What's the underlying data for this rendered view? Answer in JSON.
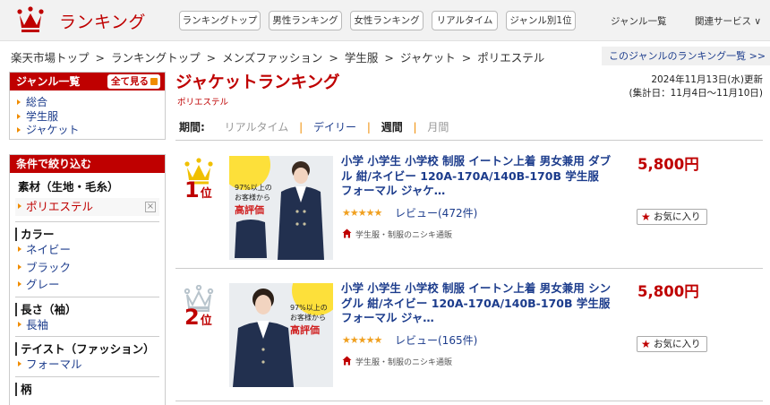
{
  "header": {
    "brand": "ランキング",
    "nav_buttons": [
      "ランキングトップ",
      "男性ランキング",
      "女性ランキング",
      "リアルタイム",
      "ジャンル別1位"
    ],
    "genre_list_link": "ジャンル一覧",
    "related_services": "関連サービス ∨"
  },
  "breadcrumb": {
    "items": [
      "楽天市場トップ",
      "ランキングトップ",
      "メンズファッション",
      "学生服",
      "ジャケット",
      "ポリエステル"
    ],
    "separator": ">"
  },
  "genre_ranking_link": "このジャンルのランキング一覧 >>",
  "sidebar": {
    "genre_title": "ジャンル一覧",
    "show_all": "全て見る",
    "genres": [
      "総合",
      "学生服",
      "ジャケット"
    ],
    "filter_title": "条件で絞り込む",
    "material_title": "素材（生地・毛糸）",
    "material_selected": "ポリエステル",
    "remove_icon_text": "×",
    "color_title": "カラー",
    "colors": [
      "ネイビー",
      "ブラック",
      "グレー"
    ],
    "sleeve_title": "長さ（袖）",
    "sleeves": [
      "長袖"
    ],
    "taste_title": "テイスト（ファッション）",
    "tastes": [
      "フォーマル"
    ],
    "pattern_title": "柄"
  },
  "main": {
    "title": "ジャケットランキング",
    "subtitle": "ポリエステル",
    "updated_line1": "2024年11月13日(水)更新",
    "updated_line2": "(集計日：11月4日～11月10日)",
    "period_label": "期間:",
    "periods": [
      {
        "label": "リアルタイム",
        "state": "disabled"
      },
      {
        "label": "デイリー",
        "state": "link"
      },
      {
        "label": "週間",
        "state": "current"
      },
      {
        "label": "月間",
        "state": "disabled"
      }
    ]
  },
  "items": [
    {
      "rank_number": "1",
      "rank_unit": "位",
      "crown_color": "#f0c000",
      "name": "小学 小学生 小学校 制服 イートン上着 男女兼用 ダブル 紺/ネイビー 120A-170A/140B-170B 学生服 フォーマル ジャケ…",
      "price": "5,800円",
      "favorite_label": "お気に入り",
      "stars": "★★★★★",
      "rating_fraction": 0.9,
      "review": "レビュー(472件)",
      "shop": "学生服・制服のニシキ通販",
      "thumb_text_line1": "97%以上の",
      "thumb_text_line2": "お客様から",
      "thumb_text_line3": "高評価"
    },
    {
      "rank_number": "2",
      "rank_unit": "位",
      "crown_color": "#b8c4cc",
      "name": "小学 小学生 小学校 制服 イートン上着 男女兼用 シングル 紺/ネイビー 120A-170A/140B-170B 学生服 フォーマル ジャ…",
      "price": "5,800円",
      "favorite_label": "お気に入り",
      "stars": "★★★★★",
      "rating_fraction": 0.9,
      "review": "レビュー(165件)",
      "shop": "学生服・制服のニシキ通販",
      "thumb_text_line1": "97%以上の",
      "thumb_text_line2": "お客様から",
      "thumb_text_line3": "高評価"
    }
  ]
}
